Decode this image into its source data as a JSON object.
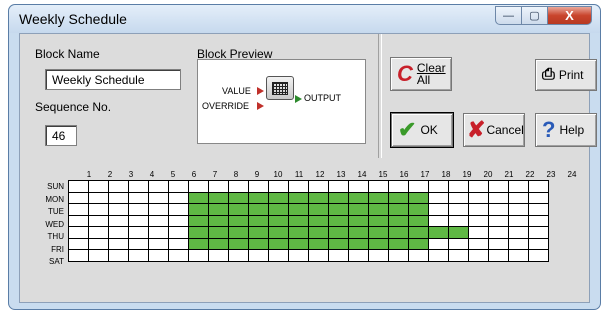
{
  "window": {
    "title": "Weekly Schedule"
  },
  "window_controls": {
    "minimize": "—",
    "maximize": "▢",
    "close": "X"
  },
  "block_name": {
    "label": "Block Name",
    "value": "Weekly Schedule"
  },
  "sequence": {
    "label": "Sequence No.",
    "value": "46"
  },
  "preview": {
    "label": "Block Preview",
    "input1": "VALUE",
    "input2": "OVERRIDE",
    "output": "OUTPUT"
  },
  "buttons": {
    "clear_line1": "Clear",
    "clear_line2": "All",
    "print": "Print",
    "ok": "OK",
    "cancel": "Cancel",
    "help": "Help"
  },
  "colors": {
    "active": "#5fb844",
    "inactive": "#ffffff"
  },
  "schedule": {
    "hours": [
      "1",
      "2",
      "3",
      "4",
      "5",
      "6",
      "7",
      "8",
      "9",
      "10",
      "11",
      "12",
      "13",
      "14",
      "15",
      "16",
      "17",
      "18",
      "19",
      "20",
      "21",
      "22",
      "23",
      "24"
    ],
    "days": [
      "SUN",
      "MON",
      "TUE",
      "WED",
      "THU",
      "FRI",
      "SAT"
    ],
    "active": [
      [],
      [
        7,
        8,
        9,
        10,
        11,
        12,
        13,
        14,
        15,
        16,
        17,
        18
      ],
      [
        7,
        8,
        9,
        10,
        11,
        12,
        13,
        14,
        15,
        16,
        17,
        18
      ],
      [
        7,
        8,
        9,
        10,
        11,
        12,
        13,
        14,
        15,
        16,
        17,
        18
      ],
      [
        7,
        8,
        9,
        10,
        11,
        12,
        13,
        14,
        15,
        16,
        17,
        18,
        19,
        20
      ],
      [
        7,
        8,
        9,
        10,
        11,
        12,
        13,
        14,
        15,
        16,
        17,
        18
      ],
      []
    ]
  }
}
